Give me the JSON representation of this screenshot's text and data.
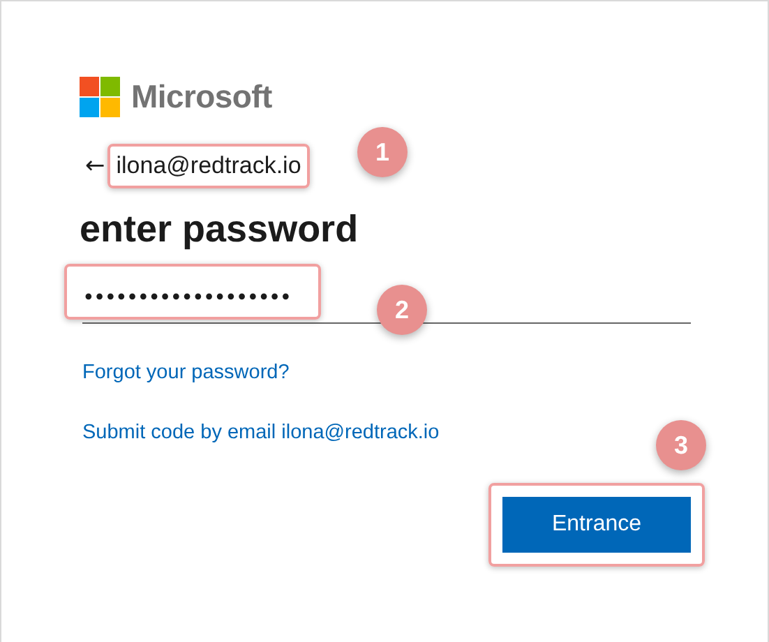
{
  "brand": {
    "name": "Microsoft"
  },
  "account": {
    "back_arrow": "←",
    "email": "ilona@redtrack.io"
  },
  "title": "enter password",
  "password": {
    "value": "•••••••••••••••••••"
  },
  "links": [
    "Forgot your password?",
    "Submit code by email ilona@redtrack.io"
  ],
  "primary_button": "Entrance",
  "markers": [
    "1",
    "2",
    "3"
  ]
}
